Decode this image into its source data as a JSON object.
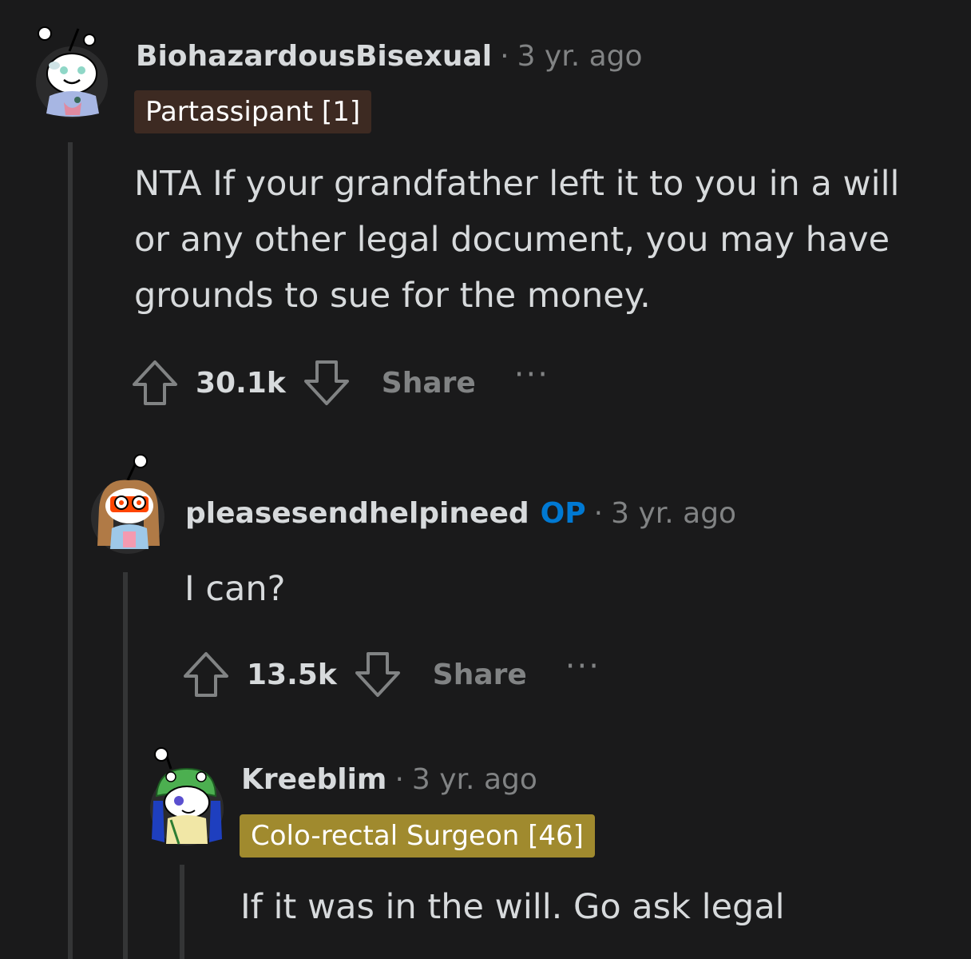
{
  "comments": [
    {
      "username": "BiohazardousBisexual",
      "separator": "·",
      "timestamp": "3 yr. ago",
      "flair": "Partassipant [1]",
      "flair_bg": "#3d2a22",
      "flair_color": "#ffffff",
      "body": "NTA If your grandfather left it to you in a will or any other legal document, you may have grounds to sue for the money.",
      "score": "30.1k",
      "share_label": "Share",
      "more_label": "···"
    },
    {
      "username": "pleasesendhelpineed",
      "op_badge": "OP",
      "separator": "·",
      "timestamp": "3 yr. ago",
      "body": "I can?",
      "score": "13.5k",
      "share_label": "Share",
      "more_label": "···"
    },
    {
      "username": "Kreeblim",
      "separator": "·",
      "timestamp": "3 yr. ago",
      "flair": "Colo-rectal Surgeon [46]",
      "flair_bg": "#a08a2e",
      "flair_color": "#ffffff",
      "body": "If it was in the will. Go ask legal"
    }
  ],
  "colors": {
    "background": "#1a1a1b",
    "text": "#d7dadc",
    "meta": "#818384",
    "op": "#0079d3",
    "thread_line": "#343536"
  },
  "icons": [
    "reddit-snoo-avatar",
    "upvote-arrow-icon",
    "downvote-arrow-icon",
    "more-options-icon"
  ]
}
